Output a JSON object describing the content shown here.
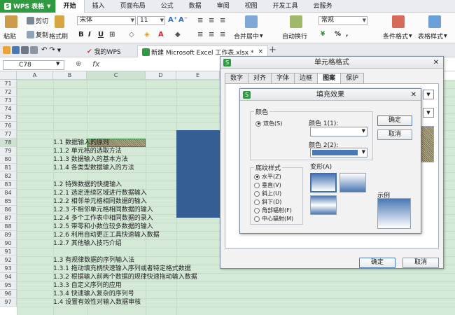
{
  "app": {
    "name": "WPS 表格"
  },
  "menu": [
    "开始",
    "插入",
    "页面布局",
    "公式",
    "数据",
    "审阅",
    "视图",
    "开发工具",
    "云服务"
  ],
  "ribbon": {
    "cut": "剪切",
    "paste": "粘贴",
    "copy": "复制",
    "format_painter": "格式刷",
    "font_name": "宋体",
    "font_size": "11",
    "merge_center": "合并居中",
    "wrap_text": "自动换行",
    "number_format": "常规",
    "conditional_format": "条件格式",
    "table_style": "表格样式"
  },
  "tabs": [
    {
      "label": "我的WPS"
    },
    {
      "label": "新建 Microsoft Excel 工作表.xlsx *"
    }
  ],
  "formula_bar": {
    "cell_ref": "C78",
    "fx": "fx"
  },
  "grid": {
    "columns": [
      "A",
      "B",
      "C",
      "D",
      "E"
    ],
    "rows": [
      "71",
      "72",
      "73",
      "74",
      "75",
      "76",
      "77",
      "78",
      "79",
      "80",
      "81",
      "82",
      "83",
      "84",
      "85",
      "86",
      "87",
      "88",
      "89",
      "90",
      "91",
      "92",
      "93",
      "94",
      "95",
      "96",
      "97"
    ],
    "cells": [
      {
        "row": "78",
        "text": "1.1 数据输入的原则"
      },
      {
        "row": "79",
        "text": "1.1.2 单元格的选取方法"
      },
      {
        "row": "80",
        "text": "1.1.3 数据输入的基本方法"
      },
      {
        "row": "81",
        "text": "1.1.4 各类型数据输入的方法"
      },
      {
        "row": "82",
        "text": ""
      },
      {
        "row": "83",
        "text": "1.2 特殊数据的快捷输入"
      },
      {
        "row": "84",
        "text": "1.2.1 选定连续区域进行数据输入"
      },
      {
        "row": "85",
        "text": "1.2.2 相邻单元格相同数据的输入"
      },
      {
        "row": "86",
        "text": "1.2.3 不相邻单元格相同数据的输入"
      },
      {
        "row": "87",
        "text": "1.2.4 多个工作表中相同数据的录入"
      },
      {
        "row": "88",
        "text": "1.2.5 带零和小数位较多数据的输入"
      },
      {
        "row": "89",
        "text": "1.2.6 利用自动更正工具快速输入数据"
      },
      {
        "row": "90",
        "text": "1.2.7 其他输入技巧介绍"
      },
      {
        "row": "91",
        "text": ""
      },
      {
        "row": "92",
        "text": "1.3 有规律数据的序列输入法"
      },
      {
        "row": "93",
        "text": "1.3.1 拖动填充柄快速输入序列或者特定格式数据"
      },
      {
        "row": "94",
        "text": "1.3.2 根据输入前两个数据的规律快速拖动输入数据"
      },
      {
        "row": "95",
        "text": "1.3.3 自定义序列的应用"
      },
      {
        "row": "96",
        "text": "1.3.4 快速输入复杂的序列号"
      },
      {
        "row": "97",
        "text": "1.4 设置有效性对输入数据审核"
      }
    ]
  },
  "format_dialog": {
    "title": "单元格格式",
    "tabs": [
      "数字",
      "对齐",
      "字体",
      "边框",
      "图案",
      "保护"
    ],
    "active_tab": "图案",
    "ok": "确定",
    "cancel": "取消"
  },
  "fill_dialog": {
    "title": "填充效果",
    "color_group": "颜色",
    "two_color": "双色(S)",
    "color1_label": "颜色 1(1):",
    "color2_label": "颜色 2(2):",
    "color1": "#ffffff",
    "color2": "#4a78b4",
    "shading_group": "底纹样式",
    "shading_options": [
      "水平(Z)",
      "垂直(V)",
      "斜上(U)",
      "斜下(D)",
      "角部辐射(F)",
      "中心辐射(M)"
    ],
    "variants_label": "变形(A)",
    "sample_label": "示例",
    "ok": "确定",
    "cancel": "取消"
  }
}
